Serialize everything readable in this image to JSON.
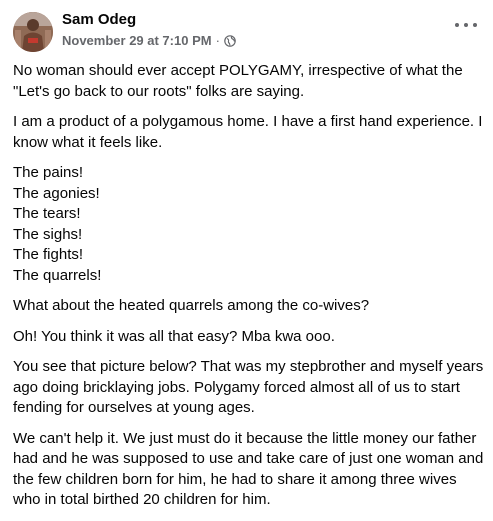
{
  "post": {
    "author": "Sam Odeg",
    "timestamp": "November 29 at 7:10 PM",
    "separator": "·",
    "privacy_icon": "globe-icon",
    "more_icon": "more-options-icon",
    "paragraphs": [
      [
        "No woman should ever accept POLYGAMY, irrespective of what the",
        "\"Let's go back to our roots\" folks are saying."
      ],
      [
        "I am a product of a polygamous home. I have a first hand experience. I",
        "know what it feels like."
      ],
      [
        "The pains!",
        "The agonies!",
        "The tears!",
        "The sighs!",
        "The fights!",
        "The quarrels!"
      ],
      [
        "What about the heated quarrels among the co-wives?"
      ],
      [
        "Oh! You think it was all that easy? Mba kwa ooo."
      ],
      [
        "You see that picture below? That was my stepbrother and myself years",
        "ago doing bricklaying jobs. Polygamy forced almost all of us to start",
        "fending for ourselves at young ages."
      ],
      [
        "We can't help it. We just must do it because the little money our father",
        "had and he was supposed to use and take care of just one woman and",
        "the few children born for him, he had to share it among three wives",
        "who in total birthed 20 children for him."
      ]
    ]
  },
  "colors": {
    "text": "#050505",
    "secondary_text": "#65676b",
    "background": "#ffffff"
  }
}
